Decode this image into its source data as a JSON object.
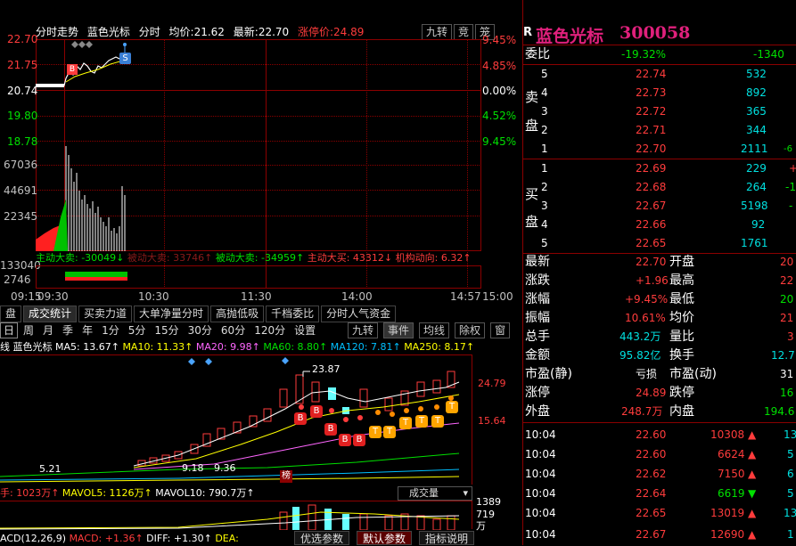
{
  "timeshare": {
    "header_title": "分时走势",
    "stock_name": "蓝色光标",
    "mode": "分时",
    "avg_label": "均价:",
    "avg_value": "21.62",
    "last_label": "最新:",
    "last_value": "22.70",
    "limit_label": "涨停价:",
    "limit_value": "24.89",
    "btn_reversal": "九转",
    "btn_bid": "竞",
    "btn_extra": "笼",
    "price_labels": [
      "22.70",
      "21.75",
      "20.74",
      "19.80",
      "18.78"
    ],
    "pct_labels": [
      "9.45%",
      "4.85%",
      "0.00%",
      "4.52%",
      "9.45%"
    ],
    "vol_labels": [
      "67036",
      "44691",
      "22345"
    ],
    "flow_header_active": "主动大卖: -30049↓",
    "flow_header_passive_sell": "被动大卖: 33746↑",
    "flow_header_passive_buy": "被动大卖: -34959↑",
    "flow_header_active_buy": "主动大买: 43312↓",
    "flow_header_inst": "机构动向: 6.32↑",
    "flow_labels": [
      "133040",
      "2746"
    ],
    "time_labels": [
      "09:15",
      "09:30",
      "10:30",
      "11:30",
      "14:00",
      "14:57",
      "15:00"
    ],
    "marker_s": "S",
    "marker_b": "B"
  },
  "tabs": [
    "盘",
    "成交统计",
    "买卖力道",
    "大单净量分时",
    "高抛低吸",
    "千档委比",
    "分时人气资金"
  ],
  "period_tabs": [
    "日",
    "周",
    "月",
    "季",
    "年",
    "1分",
    "5分",
    "15分",
    "30分",
    "60分",
    "120分",
    "设置"
  ],
  "kline_tools": [
    "九转",
    "事件",
    "均线",
    "除权",
    "窗"
  ],
  "kline": {
    "ma_label": "线",
    "stock_name": "蓝色光标",
    "ma5": "MA5: 13.67↑",
    "ma10": "MA10: 11.33↑",
    "ma20": "MA20: 9.98↑",
    "ma60": "MA60: 8.80↑",
    "ma120": "MA120: 7.81↑",
    "ma250": "MA250: 8.17↑",
    "high_label": "23.87",
    "price_top": "24.79",
    "price_mid": "15.64",
    "low_label1": "9.18",
    "low_label2": "9.36",
    "low_label3": "5.21",
    "board_label": "榜",
    "b_marker": "B",
    "t_marker": "T"
  },
  "volume": {
    "label": "手: 1023万↑",
    "mavol5": "MAVOL5: 1126万↑",
    "mavol10": "MAVOL10: 790.7万↑",
    "selector": "成交量",
    "scale_top": "1389",
    "scale_mid": "719",
    "unit": "万"
  },
  "macd": {
    "label": "ACD(12,26,9)",
    "macd": "MACD: +1.36↑",
    "diff": "DIFF: +1.30↑",
    "dea": "DEA:"
  },
  "bottom_buttons": [
    "优选参数",
    "默认参数",
    "指标说明"
  ],
  "quote": {
    "r_badge": "R",
    "name": "蓝色光标",
    "code": "300058",
    "webi_label": "委比",
    "webi_value": "-19.32%",
    "webi_diff": "-1340",
    "sell_label": [
      "卖",
      "盘"
    ],
    "buy_label": [
      "买",
      "盘"
    ],
    "sells": [
      {
        "lvl": "5",
        "price": "22.74",
        "vol": "532",
        "chg": ""
      },
      {
        "lvl": "4",
        "price": "22.73",
        "vol": "892",
        "chg": ""
      },
      {
        "lvl": "3",
        "price": "22.72",
        "vol": "365",
        "chg": ""
      },
      {
        "lvl": "2",
        "price": "22.71",
        "vol": "344",
        "chg": ""
      },
      {
        "lvl": "1",
        "price": "22.70",
        "vol": "2111",
        "chg": "-6"
      }
    ],
    "buys": [
      {
        "lvl": "1",
        "price": "22.69",
        "vol": "229",
        "chg": "+"
      },
      {
        "lvl": "2",
        "price": "22.68",
        "vol": "264",
        "chg": "-1"
      },
      {
        "lvl": "3",
        "price": "22.67",
        "vol": "5198",
        "chg": "-"
      },
      {
        "lvl": "4",
        "price": "22.66",
        "vol": "92",
        "chg": ""
      },
      {
        "lvl": "5",
        "price": "22.65",
        "vol": "1761",
        "chg": ""
      }
    ],
    "stats": [
      {
        "k1": "最新",
        "v1": "22.70",
        "k2": "开盘",
        "v2": "20"
      },
      {
        "k1": "涨跌",
        "v1": "+1.96",
        "k2": "最高",
        "v2": "22"
      },
      {
        "k1": "涨幅",
        "v1": "+9.45%",
        "k2": "最低",
        "v2": "20"
      },
      {
        "k1": "振幅",
        "v1": "10.61%",
        "k2": "均价",
        "v2": "21"
      },
      {
        "k1": "总手",
        "v1": "443.2万",
        "k2": "量比",
        "v2": "3"
      },
      {
        "k1": "金额",
        "v1": "95.82亿",
        "k2": "换手",
        "v2": "12.7"
      },
      {
        "k1": "市盈(静)",
        "v1": "亏损",
        "k2": "市盈(动)",
        "v2": "31"
      },
      {
        "k1": "涨停",
        "v1": "24.89",
        "k2": "跌停",
        "v2": "16"
      },
      {
        "k1": "外盘",
        "v1": "248.7万",
        "k2": "内盘",
        "v2": "194.6"
      }
    ],
    "ticks": [
      {
        "time": "10:04",
        "price": "22.60",
        "vol": "10308",
        "arrow": "up",
        "extra": "13"
      },
      {
        "time": "10:04",
        "price": "22.60",
        "vol": "6624",
        "arrow": "up",
        "extra": "5"
      },
      {
        "time": "10:04",
        "price": "22.62",
        "vol": "7150",
        "arrow": "up",
        "extra": "6"
      },
      {
        "time": "10:04",
        "price": "22.64",
        "vol": "6619",
        "arrow": "down",
        "extra": "5"
      },
      {
        "time": "10:04",
        "price": "22.65",
        "vol": "13019",
        "arrow": "up",
        "extra": "13"
      },
      {
        "time": "10:04",
        "price": "22.67",
        "vol": "12690",
        "arrow": "up",
        "extra": "1"
      }
    ]
  }
}
